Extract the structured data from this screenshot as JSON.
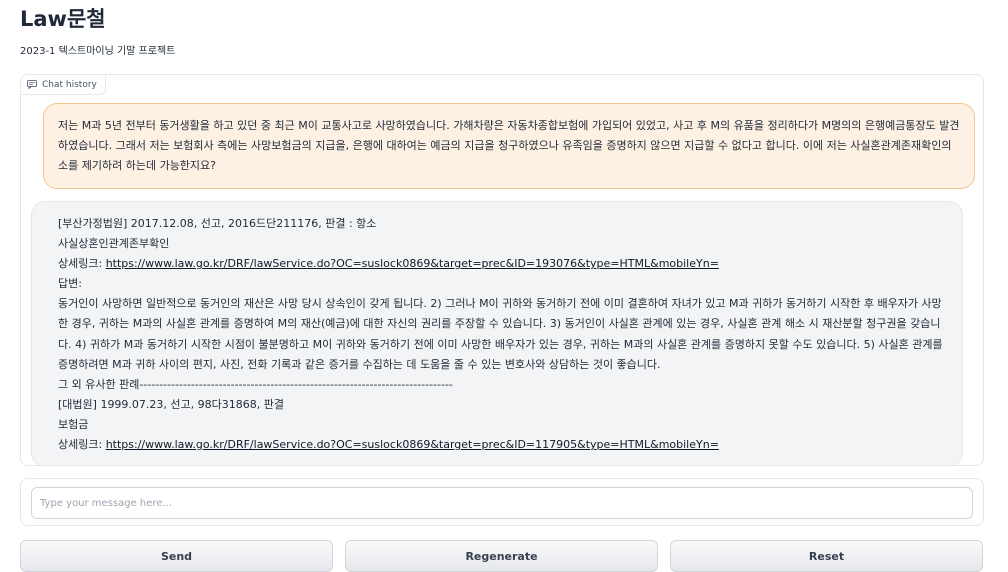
{
  "header": {
    "title": "Law문철",
    "subtitle": "2023-1 텍스트마이닝 기말 프로젝트"
  },
  "chat": {
    "label": "Chat history",
    "icon": "chat-bubble-icon",
    "user_message": "저는 M과 5년 전부터 동거생활을 하고 있던 중 최근 M이 교통사고로 사망하였습니다. 가해차량은 자동차종합보험에 가입되어 있었고, 사고 후 M의 유품을 정리하다가 M명의의 은행예금통장도 발견하였습니다. 그래서 저는 보험회사 측에는 사망보험금의 지급을, 은행에 대하여는 예금의 지급을 청구하였으나 유족임을 증명하지 않으면 지급할 수 없다고 합니다. 이에 저는 사실혼관계존재확인의 소를 제기하려 하는데 가능한지요?",
    "bot": {
      "case1_header": "[부산가정법원] 2017.12.08, 선고, 2016드단211176, 판결 : 항소",
      "case1_title": "사실상혼인관계존부확인",
      "link_prefix": "상세링크: ",
      "case1_link": "https://www.law.go.kr/DRF/lawService.do?OC=suslock0869&target=prec&ID=193076&type=HTML&mobileYn=",
      "answer_label": "답변:",
      "answer_text": "동거인이 사망하면 일반적으로 동거인의 재산은 사망 당시 상속인이 갖게 됩니다. 2) 그러나 M이 귀하와 동거하기 전에 이미 결혼하여 자녀가 있고 M과 귀하가 동거하기 시작한 후 배우자가 사망한 경우, 귀하는 M과의 사실혼 관계를 증명하여 M의 재산(예금)에 대한 자신의 권리를 주장할 수 있습니다. 3) 동거인이 사실혼 관계에 있는 경우, 사실혼 관계 해소 시 재산분할 청구권을 갖습니다. 4) 귀하가 M과 동거하기 시작한 시점이 불분명하고 M이 귀하와 동거하기 전에 이미 사망한 배우자가 있는 경우, 귀하는 M과의 사실혼 관계를 증명하지 못할 수도 있습니다. 5) 사실혼 관계를 증명하려면 M과 귀하 사이의 편지, 사진, 전화 기록과 같은 증거를 수집하는 데 도움을 줄 수 있는 변호사와 상담하는 것이 좋습니다.",
      "similar_label": "그 외 유사한 판례-------------------------------------------------------------------------------",
      "case2_header": "[대법원] 1999.07.23, 선고, 98다31868, 판결",
      "case2_title": "보험금",
      "case2_link": "https://www.law.go.kr/DRF/lawService.do?OC=suslock0869&target=prec&ID=117905&type=HTML&mobileYn="
    }
  },
  "input": {
    "placeholder": "Type your message here...",
    "value": ""
  },
  "buttons": {
    "send": "Send",
    "regenerate": "Regenerate",
    "reset": "Reset"
  },
  "colors": {
    "user_bubble_bg": "#fdf1e3",
    "user_bubble_border": "#f4c590",
    "bot_bubble_bg": "#f3f4f6"
  }
}
